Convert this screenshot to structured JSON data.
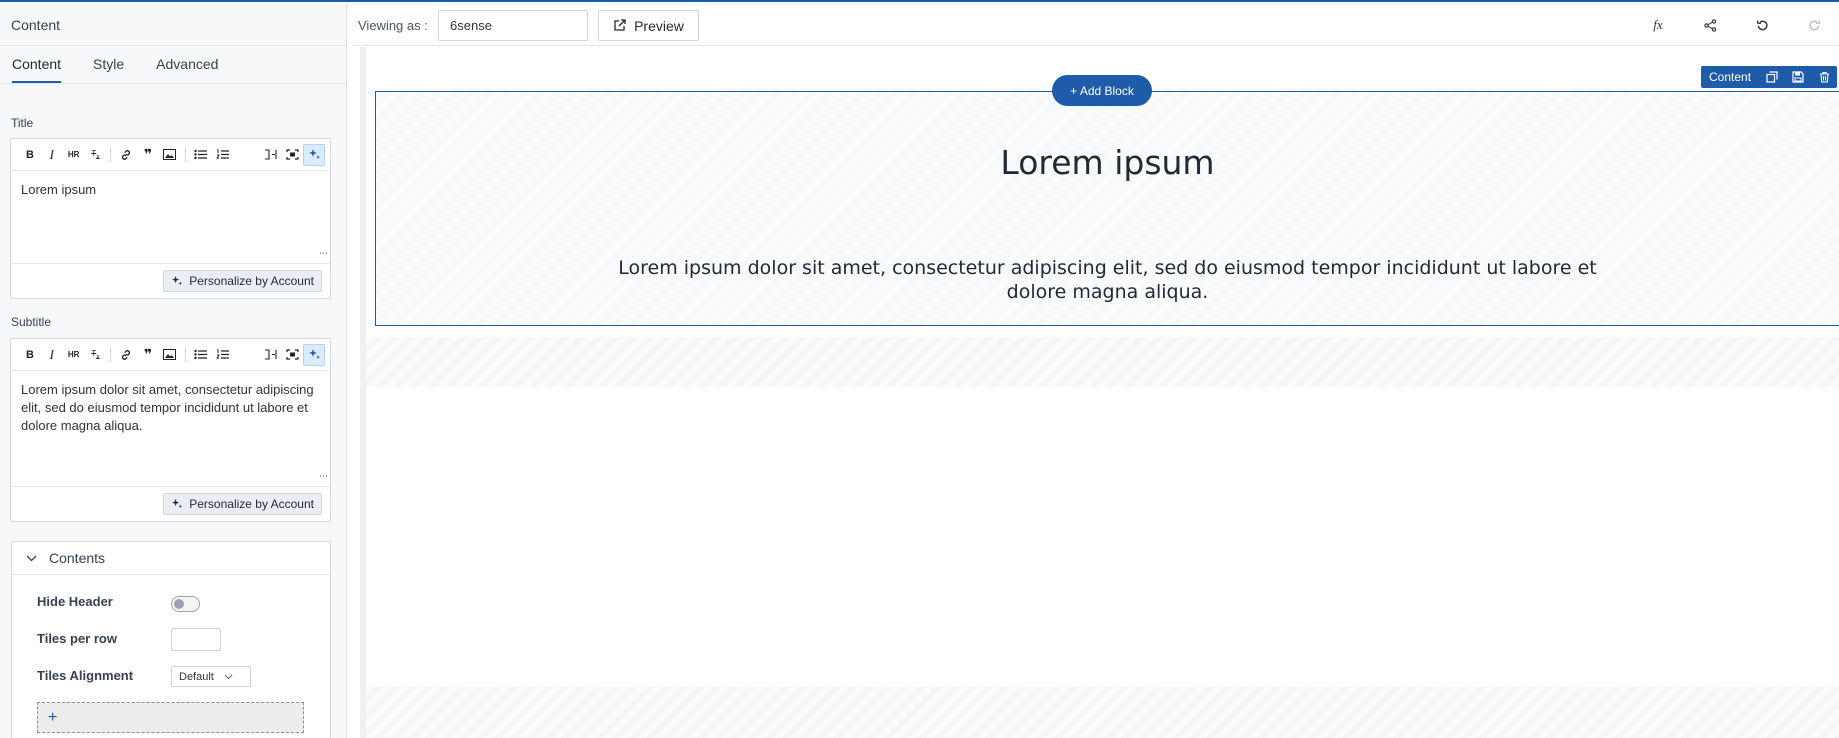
{
  "panel": {
    "title": "Content",
    "tabs": [
      "Content",
      "Style",
      "Advanced"
    ],
    "title_field": {
      "label": "Title",
      "value": "Lorem ipsum",
      "personalize_label": "Personalize by Account"
    },
    "subtitle_field": {
      "label": "Subtitle",
      "value": "Lorem ipsum dolor sit amet, consectetur adipiscing elit, sed do eiusmod tempor incididunt ut labore et dolore magna aliqua.",
      "personalize_label": "Personalize by Account"
    },
    "toolbar_icons": [
      "bold-icon",
      "italic-icon",
      "hr-icon",
      "clear-format-icon",
      "link-icon",
      "quote-icon",
      "image-icon",
      "bullet-list-icon",
      "numbered-list-icon",
      "fullwidth-icon",
      "fullscreen-icon",
      "ai-sparkle-icon"
    ],
    "contents": {
      "header": "Contents",
      "hide_header_label": "Hide Header",
      "hide_header_on": false,
      "tiles_per_row_label": "Tiles per row",
      "tiles_per_row_value": "",
      "tiles_alignment_label": "Tiles Alignment",
      "tiles_alignment_value": "Default",
      "add_tile_label": "+"
    }
  },
  "topbar": {
    "viewing_as_label": "Viewing as :",
    "viewing_as_value": "6sense",
    "preview_label": "Preview",
    "fx_label": "fx"
  },
  "canvas": {
    "add_block_label": "+ Add Block",
    "block_toolbar_label": "Content",
    "block_title": "Lorem ipsum",
    "block_subtitle": "Lorem ipsum dolor sit amet, consectetur adipiscing elit, sed do eiusmod tempor incididunt ut labore et dolore magna aliqua."
  },
  "colors": {
    "accent": "#1e5ba8"
  }
}
